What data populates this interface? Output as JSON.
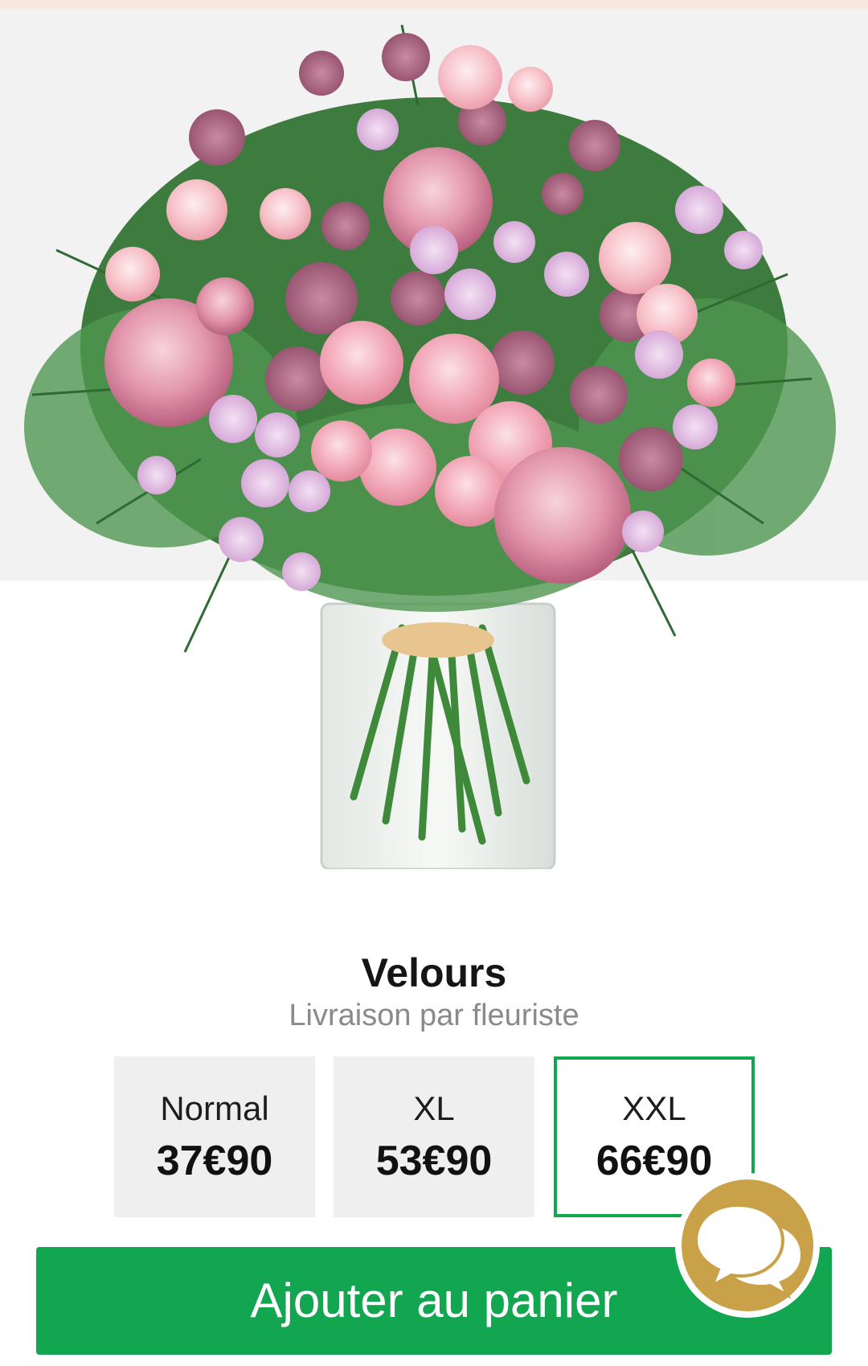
{
  "product": {
    "name": "Velours",
    "delivery": "Livraison par fleuriste"
  },
  "sizes": [
    {
      "label": "Normal",
      "price": "37€90",
      "selected": false
    },
    {
      "label": "XL",
      "price": "53€90",
      "selected": false
    },
    {
      "label": "XXL",
      "price": "66€90",
      "selected": true
    }
  ],
  "actions": {
    "add_to_cart": "Ajouter au panier"
  },
  "colors": {
    "accent_green": "#12a651",
    "chat_gold": "#c9a148",
    "top_strip": "#f6e7e0"
  },
  "icons": {
    "chat": "chat-bubbles-icon"
  }
}
